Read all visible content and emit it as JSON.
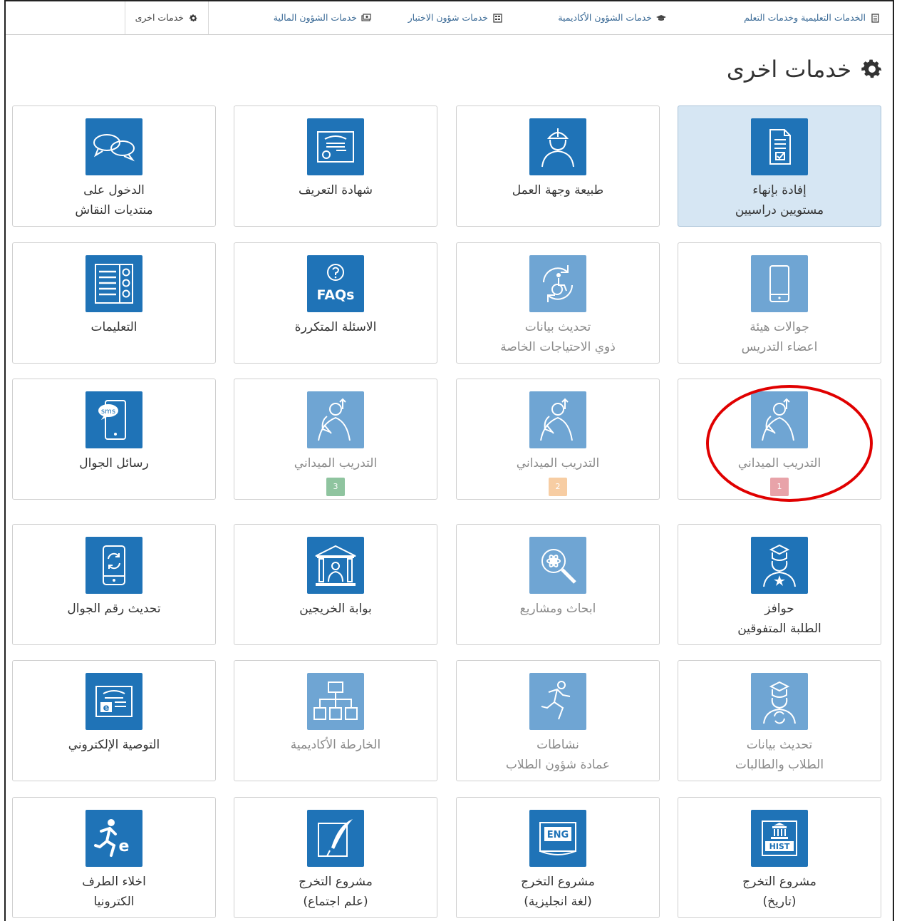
{
  "topnav": {
    "items": [
      {
        "label": "الخدمات التعليمية وخدمات التعلم",
        "icon": "document-list-icon"
      },
      {
        "label": "خدمات الشؤون الأكاديمية",
        "icon": "graduation-cap-icon"
      },
      {
        "label": "خدمات شؤون الاختبار",
        "icon": "calendar-grid-icon"
      },
      {
        "label": "خدمات الشؤون المالية",
        "icon": "money-icon"
      },
      {
        "label": "خدمات اخرى",
        "icon": "gear-icon"
      }
    ]
  },
  "page": {
    "title": "خدمات اخرى",
    "title_icon": "gear-icon"
  },
  "tiles": [
    {
      "line1": "إفادة بإنهاء",
      "line2": "مستويين دراسيين",
      "icon": "certificate-document-icon",
      "state": "selected"
    },
    {
      "line1": "طبيعة وجهة العمل",
      "line2": "",
      "icon": "worker-helmet-icon",
      "state": "normal"
    },
    {
      "line1": "شهادة التعريف",
      "line2": "",
      "icon": "id-certificate-icon",
      "state": "normal"
    },
    {
      "line1": "الدخول على",
      "line2": "منتديات النقاش",
      "icon": "chat-bubbles-icon",
      "state": "normal"
    },
    {
      "line1": "جوالات هيئة",
      "line2": "اعضاء التدريس",
      "icon": "mobile-phone-icon",
      "state": "faded"
    },
    {
      "line1": "تحديث بيانات",
      "line2": "ذوي الاحتياجات الخاصة",
      "icon": "wheelchair-refresh-icon",
      "state": "faded"
    },
    {
      "line1": "الاسئلة المتكررة",
      "line2": "",
      "icon": "faqs-icon",
      "icon_text": "FAQs",
      "state": "normal"
    },
    {
      "line1": "التعليمات",
      "line2": "",
      "icon": "instructions-list-icon",
      "state": "normal"
    },
    {
      "line1": "التدريب الميداني",
      "line2": "",
      "icon": "field-trainer-icon",
      "state": "faded",
      "badge": "1"
    },
    {
      "line1": "التدريب الميداني",
      "line2": "",
      "icon": "field-trainer-icon",
      "state": "faded",
      "badge": "2"
    },
    {
      "line1": "التدريب الميداني",
      "line2": "",
      "icon": "field-trainer-icon",
      "state": "faded",
      "badge": "3"
    },
    {
      "line1": "رسائل الجوال",
      "line2": "",
      "icon": "sms-phone-icon",
      "icon_text": "sms",
      "state": "normal"
    },
    {
      "line1": "حوافز",
      "line2": "الطلبة المتفوقين",
      "icon": "graduate-star-icon",
      "state": "normal"
    },
    {
      "line1": "ابحاث ومشاريع",
      "line2": "",
      "icon": "research-magnifier-icon",
      "state": "faded"
    },
    {
      "line1": "بوابة الخريجين",
      "line2": "",
      "icon": "graduates-portal-icon",
      "state": "normal"
    },
    {
      "line1": "تحديث رقم الجوال",
      "line2": "",
      "icon": "mobile-refresh-icon",
      "state": "normal"
    },
    {
      "line1": "تحديث بيانات",
      "line2": "الطلاب والطالبات",
      "icon": "student-refresh-icon",
      "state": "faded"
    },
    {
      "line1": "نشاطات",
      "line2": "عمادة شؤون الطلاب",
      "icon": "running-person-icon",
      "state": "faded"
    },
    {
      "line1": "الخارطة الأكاديمية",
      "line2": "",
      "icon": "org-chart-icon",
      "state": "faded"
    },
    {
      "line1": "التوصية الإلكتروني",
      "line2": "",
      "icon": "e-certificate-icon",
      "icon_text": "e",
      "state": "normal"
    },
    {
      "line1": "مشروع التخرج",
      "line2": "(تاريخ)",
      "icon": "history-book-icon",
      "icon_text": "HIST",
      "state": "normal"
    },
    {
      "line1": "مشروع التخرج",
      "line2": "(لغة انجليزية)",
      "icon": "english-book-icon",
      "icon_text": "ENG",
      "state": "normal"
    },
    {
      "line1": "مشروع التخرج",
      "line2": "(علم اجتماع)",
      "icon": "quill-book-icon",
      "state": "normal"
    },
    {
      "line1": "اخلاء الطرف",
      "line2": "الكترونيا",
      "icon": "e-exit-runner-icon",
      "icon_text": "e",
      "state": "normal"
    }
  ],
  "annotation": {
    "highlight": "red-circle-around-field-training-1",
    "color": "#e00000"
  },
  "colors": {
    "icon_bg": "#1f73b7",
    "icon_bg_faded": "#6fa5d3",
    "selected_bg": "#d6e6f3",
    "link": "#3a6a96"
  }
}
